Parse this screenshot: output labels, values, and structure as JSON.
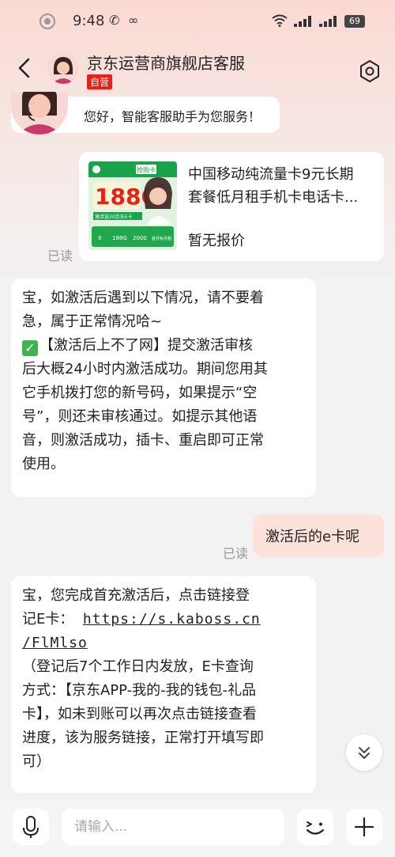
{
  "status_bar": {
    "time": "9:48",
    "battery": "69"
  },
  "header": {
    "title": "京东运营商旗舰店客服",
    "badge": "自营"
  },
  "welcome": {
    "text": "您好，智能客服助手为您服务！"
  },
  "product_card": {
    "title_line1": "中国移动纯流量卡9元长期",
    "title_line2": "套餐低月租手机卡电话卡...",
    "price": "暂无报价",
    "image": {
      "tag": "抢购卡",
      "big": "188G",
      "mid": "激活送20京东E卡",
      "stats": [
        "9",
        "188G",
        "2000",
        "首月免月租"
      ]
    }
  },
  "read_label": "已读",
  "msg1": {
    "line1": "宝，如激活后遇到以下情况，请不要着",
    "line2": "急，属于正常情况哈~",
    "line3": "【激活后上不了网】提交激活审核",
    "line4": "后大概24小时内激活成功。期间您用其",
    "line5": "它手机拨打您的新号码，如果提示“空",
    "line6": "号”，则还未审核通过。如提示其他语",
    "line7": "音，则激活成功，插卡、重启即可正常",
    "line8": "使用。"
  },
  "user_msg": {
    "text": "激活后的e卡呢"
  },
  "msg2": {
    "line1": "宝，您完成首充激活后，点击链接登",
    "line2_prefix": "记E卡：",
    "link_part1": "https://s.kaboss.cn",
    "link_part2": "/FlMlso",
    "line4": "（登记后7个工作日内发放，E卡查询",
    "line5": "方式：【京东APP-我的-我的钱包-礼品",
    "line6": "卡】，如未到账可以再次点击链接查看",
    "line7": "进度，该为服务链接，正常打开填写即",
    "line8": "可）"
  },
  "input": {
    "placeholder": "请输入..."
  }
}
